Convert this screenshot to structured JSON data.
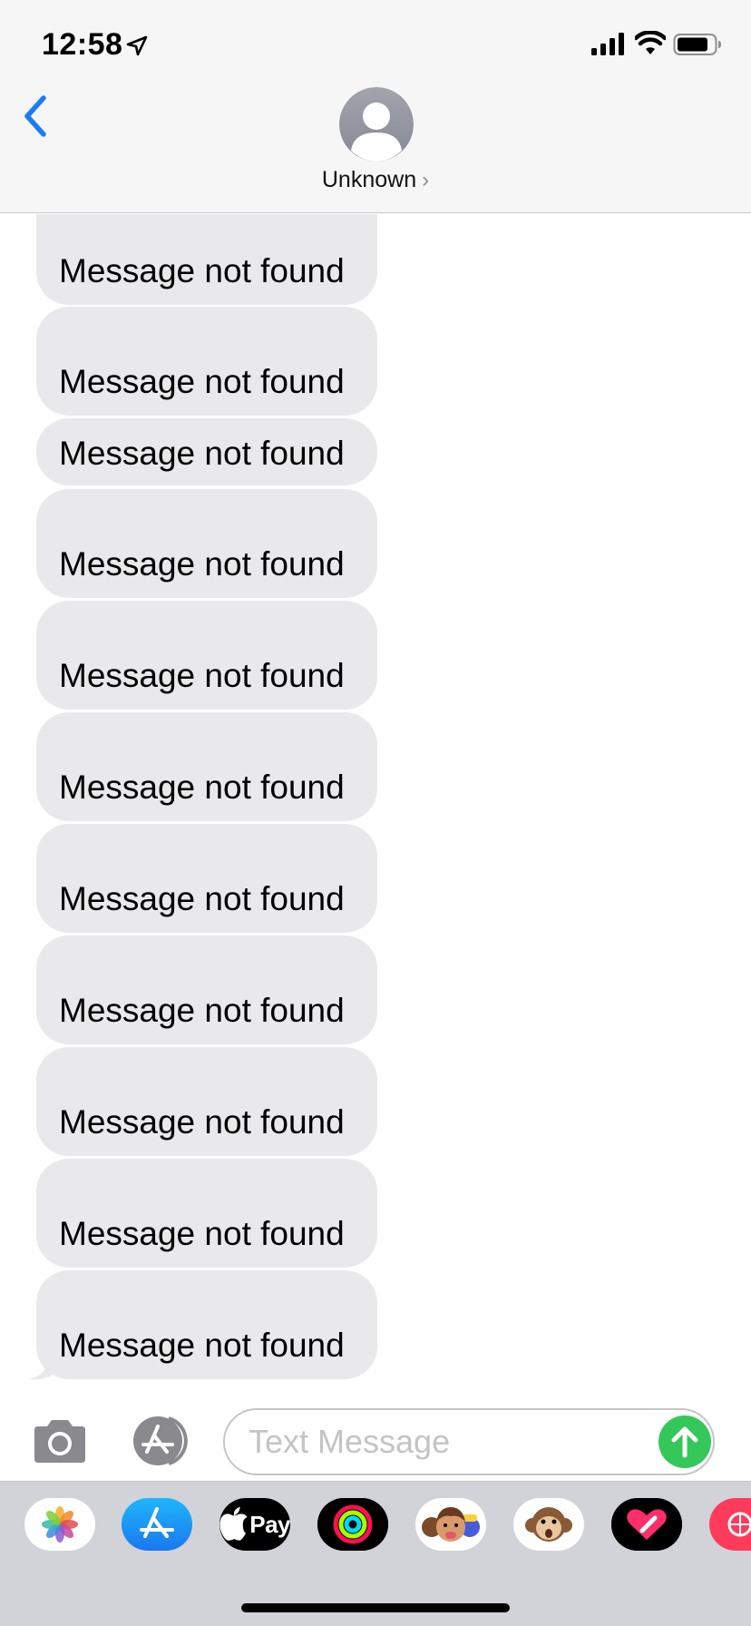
{
  "status_bar": {
    "time": "12:58"
  },
  "header": {
    "contact_name": "Unknown",
    "chevron": "›"
  },
  "messages": [
    {
      "text": "Message not found"
    },
    {
      "text": "Message not found"
    },
    {
      "text": "Message not found"
    },
    {
      "text": "Message not found"
    },
    {
      "text": "Message not found"
    },
    {
      "text": "Message not found"
    },
    {
      "text": "Message not found"
    },
    {
      "text": "Message not found"
    },
    {
      "text": "Message not found"
    },
    {
      "text": "Message not found"
    },
    {
      "text": "Message not found"
    }
  ],
  "compose": {
    "placeholder": "Text Message"
  },
  "app_drawer": {
    "apps": [
      {
        "name": "photos-icon"
      },
      {
        "name": "app-store-icon"
      },
      {
        "name": "apple-pay-icon",
        "label": "Pay"
      },
      {
        "name": "activity-icon"
      },
      {
        "name": "memoji-icon"
      },
      {
        "name": "animoji-monkey-icon"
      },
      {
        "name": "digital-touch-icon"
      },
      {
        "name": "search-images-icon"
      }
    ]
  },
  "colors": {
    "bubble_gray": "#e9e9eb",
    "ios_blue": "#1b7cf5",
    "send_green": "#34c759",
    "header_bg": "#f6f6f7",
    "drawer_bg": "#d1d3d9"
  }
}
